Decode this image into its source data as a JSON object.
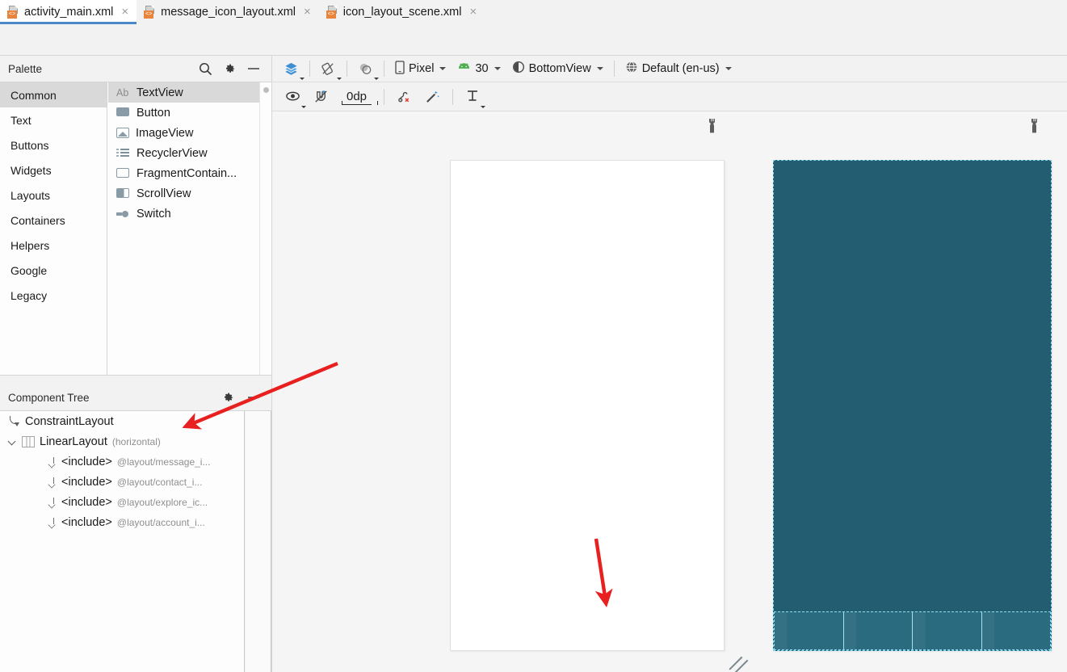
{
  "editor_tabs": [
    {
      "label": "activity_main.xml",
      "icon": "xml-layout-file-icon",
      "active": true,
      "close_icon": "close-icon"
    },
    {
      "label": "message_icon_layout.xml",
      "icon": "xml-layout-file-icon",
      "active": false,
      "close_icon": "close-icon"
    },
    {
      "label": "icon_layout_scene.xml",
      "icon": "xml-layout-file-icon",
      "active": false,
      "close_icon": "close-icon"
    }
  ],
  "palette": {
    "title": "Palette",
    "header_actions": [
      {
        "name": "search-icon",
        "label": "Search"
      },
      {
        "name": "gear-icon",
        "label": "Palette Settings"
      },
      {
        "name": "minimize-icon",
        "label": "Hide"
      }
    ],
    "categories": [
      {
        "label": "Common",
        "selected": true
      },
      {
        "label": "Text",
        "selected": false
      },
      {
        "label": "Buttons",
        "selected": false
      },
      {
        "label": "Widgets",
        "selected": false
      },
      {
        "label": "Layouts",
        "selected": false
      },
      {
        "label": "Containers",
        "selected": false
      },
      {
        "label": "Helpers",
        "selected": false
      },
      {
        "label": "Google",
        "selected": false
      },
      {
        "label": "Legacy",
        "selected": false
      }
    ],
    "items": [
      {
        "label": "TextView",
        "icon": "text-ab-icon",
        "icon_text": "Ab",
        "selected": true
      },
      {
        "label": "Button",
        "icon": "button-icon",
        "icon_text": "",
        "selected": false
      },
      {
        "label": "ImageView",
        "icon": "image-icon",
        "icon_text": "",
        "selected": false
      },
      {
        "label": "RecyclerView",
        "icon": "list-icon",
        "icon_text": "",
        "selected": false
      },
      {
        "label": "FragmentContain...",
        "icon": "fragment-icon",
        "icon_text": "",
        "selected": false
      },
      {
        "label": "ScrollView",
        "icon": "scrollview-icon",
        "icon_text": "",
        "selected": false
      },
      {
        "label": "Switch",
        "icon": "switch-icon",
        "icon_text": "",
        "selected": false
      }
    ]
  },
  "component_tree": {
    "title": "Component Tree",
    "header_actions": [
      {
        "name": "gear-icon",
        "label": "Settings"
      },
      {
        "name": "minimize-icon",
        "label": "Hide"
      }
    ],
    "nodes": [
      {
        "label": "ConstraintLayout",
        "detail": "",
        "icon": "constraintlayout-icon",
        "indent": 0,
        "expander": false
      },
      {
        "label": "LinearLayout",
        "detail": "(horizontal)",
        "icon": "linearlayout-icon",
        "indent": 0,
        "expander": true
      },
      {
        "label": "<include>",
        "detail": "@layout/message_i...",
        "icon": "include-icon",
        "indent": 2,
        "expander": false
      },
      {
        "label": "<include>",
        "detail": "@layout/contact_i...",
        "icon": "include-icon",
        "indent": 2,
        "expander": false
      },
      {
        "label": "<include>",
        "detail": "@layout/explore_ic...",
        "icon": "include-icon",
        "indent": 2,
        "expander": false
      },
      {
        "label": "<include>",
        "detail": "@layout/account_i...",
        "icon": "include-icon",
        "indent": 2,
        "expander": false
      }
    ]
  },
  "design_toolbar": {
    "mode_icon": {
      "name": "design-blueprint-mode-icon",
      "label": "Select Design Surface"
    },
    "orientation_icon": {
      "name": "orientation-rotate-icon",
      "label": "Orientation for Preview"
    },
    "theme_icon": {
      "name": "theme-icon",
      "label": "App Theme"
    },
    "device": {
      "label": "Pixel",
      "icon": "phone-icon"
    },
    "api_level": {
      "label": "30",
      "icon": "android-icon"
    },
    "theme": {
      "label": "BottomView",
      "icon": "theme-contrast-icon"
    },
    "locale": {
      "label": "Default (en-us)",
      "icon": "globe-icon"
    }
  },
  "constraint_toolbar": {
    "view_options": {
      "name": "eye-icon",
      "label": "View Options"
    },
    "autoconnect": {
      "name": "magnet-off-icon",
      "label": "Turn On Autoconnect"
    },
    "default_margin": {
      "value": "0dp",
      "label": "Default Margins"
    },
    "clear_constraints": {
      "name": "clear-constraints-icon",
      "label": "Clear All Constraints"
    },
    "infer_constraints": {
      "name": "magic-wand-icon",
      "label": "Infer Constraints"
    },
    "align": {
      "name": "align-icon",
      "label": "Align"
    }
  },
  "canvas": {
    "design_surface": {
      "name": "design-preview",
      "wrench_icon": "wrench-icon",
      "background": "#ffffff"
    },
    "blueprint_surface": {
      "name": "blueprint-preview",
      "wrench_icon": "wrench-icon",
      "background": "#235d72",
      "linear_layout_bar_color": "#2b6b80",
      "cell_count": 4
    },
    "resize_handle": "resize-handle-icon"
  },
  "annotations": {
    "accent_color": "#e8201f",
    "arrows": [
      {
        "name": "annotation-arrow-to-constraintlayout",
        "from": [
          418,
          450
        ],
        "to": [
          228,
          528
        ]
      },
      {
        "name": "annotation-arrow-to-design-preview",
        "from": [
          739,
          666
        ],
        "to": [
          751,
          752
        ]
      }
    ]
  }
}
